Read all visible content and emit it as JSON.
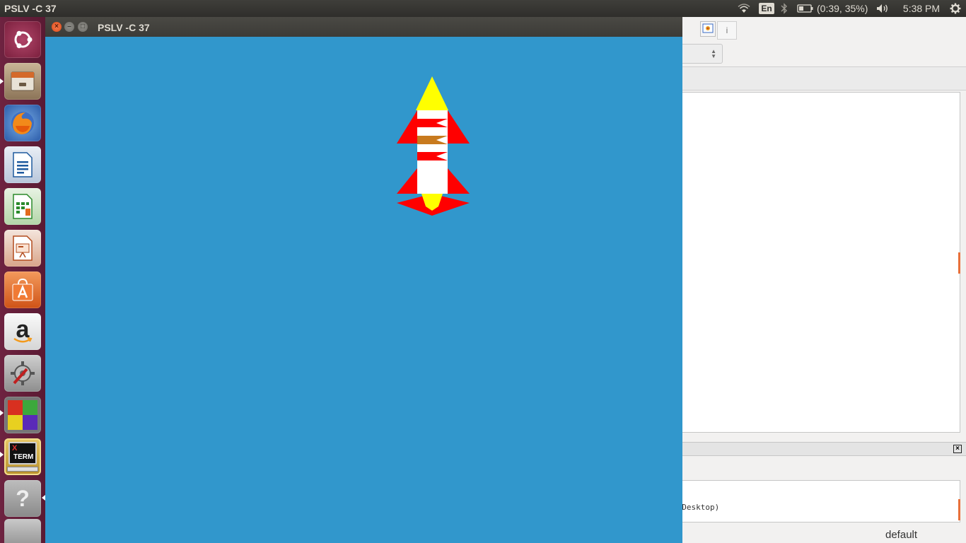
{
  "top_panel": {
    "app_title": "PSLV -C 37",
    "language": "En",
    "battery": "(0:39, 35%)",
    "clock": "5:38 PM"
  },
  "launcher": {
    "items": [
      {
        "name": "ubuntu-dash",
        "color": "#8a2a4a"
      },
      {
        "name": "files",
        "color": "#a58a6a"
      },
      {
        "name": "firefox",
        "color": "#e66000"
      },
      {
        "name": "libreoffice-writer",
        "color": "#1f5a9e"
      },
      {
        "name": "libreoffice-calc",
        "color": "#2b8a2b"
      },
      {
        "name": "libreoffice-impress",
        "color": "#b34c1e"
      },
      {
        "name": "software-center",
        "color": "#e0682a"
      },
      {
        "name": "amazon",
        "color": "#e9e9e9"
      },
      {
        "name": "system-settings",
        "color": "#9a9a9a"
      },
      {
        "name": "colored-app",
        "color": "#c03020"
      },
      {
        "name": "xterm",
        "color": "#d2b150"
      },
      {
        "name": "help",
        "color": "#9d9d9d"
      }
    ],
    "amazon_glyph": "a",
    "help_glyph": "?",
    "xterm_label_1": "X",
    "xterm_label_2": "TERM"
  },
  "window": {
    "title": "PSLV -C 37",
    "canvas_color": "#3197cc"
  },
  "rocket": {
    "nose_color": "#ffff00",
    "body_color": "#ffffff",
    "fin_color": "#ff0000",
    "band_accent_color": "#c87a1e",
    "flame_color": "#ffff00"
  },
  "background_window": {
    "console_text": "k/Desktop)",
    "status_text": "default",
    "toolbar_icon": "i"
  }
}
